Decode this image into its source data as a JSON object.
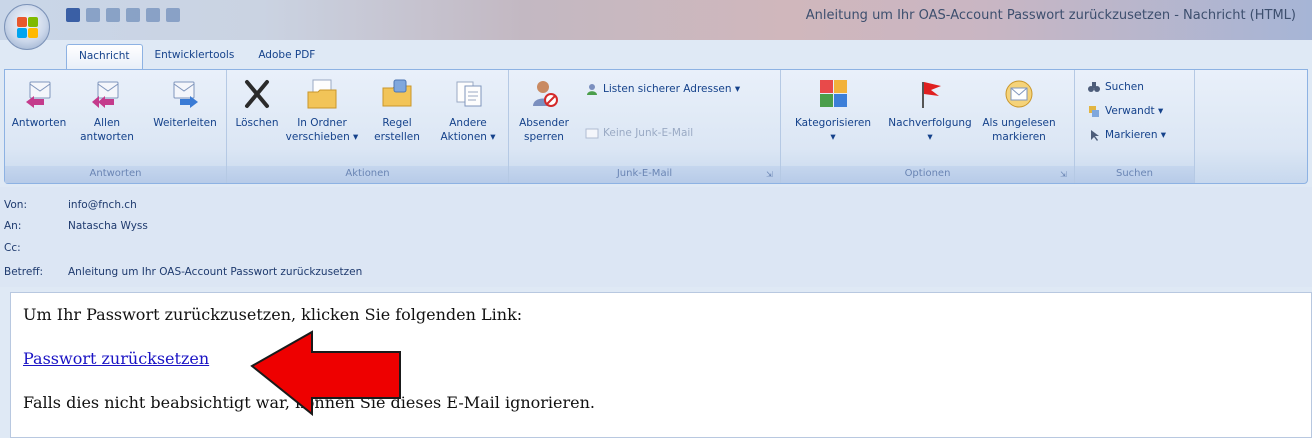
{
  "window": {
    "title": "Anleitung um Ihr OAS-Account Passwort zurückzusetzen - Nachricht (HTML)"
  },
  "tabs": [
    {
      "label": "Nachricht",
      "active": true
    },
    {
      "label": "Entwicklertools",
      "active": false
    },
    {
      "label": "Adobe PDF",
      "active": false
    }
  ],
  "ribbon": {
    "antworten": {
      "label": "Antworten",
      "buttons": [
        {
          "l1": "Antworten",
          "l2": "",
          "icon": "reply-icon"
        },
        {
          "l1": "Allen",
          "l2": "antworten",
          "icon": "reply-all-icon"
        },
        {
          "l1": "Weiterleiten",
          "l2": "",
          "icon": "forward-icon"
        }
      ]
    },
    "aktionen": {
      "label": "Aktionen",
      "buttons": [
        {
          "l1": "Löschen",
          "l2": "",
          "icon": "delete-icon"
        },
        {
          "l1": "In Ordner",
          "l2": "verschieben ▾",
          "icon": "move-to-folder-icon"
        },
        {
          "l1": "Regel",
          "l2": "erstellen",
          "icon": "create-rule-icon"
        },
        {
          "l1": "Andere",
          "l2": "Aktionen ▾",
          "icon": "other-actions-icon"
        }
      ]
    },
    "junk": {
      "label": "Junk-E-Mail",
      "sender_l1": "Absender",
      "sender_l2": "sperren",
      "safe_list": "Listen sicherer Adressen ▾",
      "not_junk": "Keine Junk-E-Mail"
    },
    "optionen": {
      "label": "Optionen",
      "buttons": [
        {
          "l1": "Kategorisieren",
          "l2": "▾",
          "icon": "categorize-icon"
        },
        {
          "l1": "Nachverfolgung",
          "l2": "▾",
          "icon": "follow-up-flag-icon"
        },
        {
          "l1": "Als ungelesen",
          "l2": "markieren",
          "icon": "mark-unread-icon"
        }
      ]
    },
    "suchen": {
      "label": "Suchen",
      "find": "Suchen",
      "related": "Verwandt ▾",
      "select": "Markieren ▾"
    }
  },
  "header": {
    "from_label": "Von:",
    "from_value": "info@fnch.ch",
    "to_label": "An:",
    "to_value": "Natascha Wyss",
    "cc_label": "Cc:",
    "cc_value": "",
    "subject_label": "Betreff:",
    "subject_value": "Anleitung um Ihr OAS-Account Passwort zurückzusetzen"
  },
  "body": {
    "line1": "Um Ihr Passwort zurückzusetzen, klicken Sie folgenden Link:",
    "link": "Passwort zurücksetzen",
    "line3": "Falls dies nicht beabsichtigt war, können Sie dieses E-Mail ignorieren."
  },
  "colors": {
    "arrow": "#ee0000",
    "link": "#1a13c4",
    "ribbon_text": "#15428b"
  }
}
